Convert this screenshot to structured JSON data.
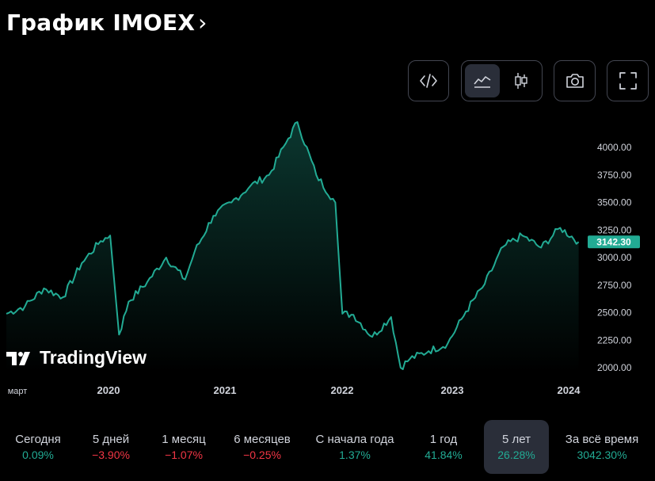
{
  "header": {
    "title": "График IMOEX",
    "chevron": "›"
  },
  "toolbar": {
    "buttons": [
      {
        "name": "embed-code",
        "icon": "code-icon"
      },
      {
        "name": "area-chart",
        "icon": "area-chart-icon",
        "active": true
      },
      {
        "name": "candles-chart",
        "icon": "candles-icon"
      },
      {
        "name": "snapshot",
        "icon": "camera-icon"
      },
      {
        "name": "fullscreen",
        "icon": "fullscreen-icon"
      }
    ]
  },
  "branding": {
    "logo_text": "TradingView"
  },
  "colors": {
    "line": "#22ab94",
    "badge": "#22ab94",
    "positive": "#22ab94",
    "negative": "#f23645"
  },
  "chart_data": {
    "type": "area",
    "symbol": "IMOEX",
    "last_value_label": "3142.30",
    "x_tick_labels": [
      "март",
      "2020",
      "2021",
      "2022",
      "2023",
      "2024"
    ],
    "y_tick_labels": [
      "4000.00",
      "3750.00",
      "3500.00",
      "3250.00",
      "3000.00",
      "2750.00",
      "2500.00",
      "2250.00",
      "2000.00"
    ],
    "ylim": [
      2000,
      4000
    ],
    "grid": false,
    "series": [
      {
        "x": [
          "2019-03",
          "2019-05",
          "2019-07",
          "2019-09",
          "2019-11",
          "2020-01",
          "2020-02",
          "2020-03",
          "2020-04",
          "2020-06",
          "2020-08",
          "2020-10",
          "2020-11",
          "2021-01",
          "2021-03",
          "2021-05",
          "2021-07",
          "2021-09",
          "2021-10",
          "2021-12",
          "2022-02",
          "2022-02-24",
          "2022-04",
          "2022-06",
          "2022-08",
          "2022-09",
          "2022-10",
          "2022-12",
          "2023-02",
          "2023-04",
          "2023-06",
          "2023-08",
          "2023-10",
          "2023-12",
          "2024-02",
          "2024-04"
        ],
        "y": [
          2490,
          2560,
          2720,
          2640,
          2950,
          3150,
          3200,
          2300,
          2600,
          2780,
          3000,
          2800,
          3050,
          3380,
          3500,
          3650,
          3750,
          4080,
          4230,
          3750,
          3500,
          2490,
          2480,
          2280,
          2460,
          2000,
          2080,
          2150,
          2220,
          2510,
          2760,
          3100,
          3200,
          3090,
          3270,
          3142
        ]
      }
    ]
  },
  "periods": [
    {
      "label": "Сегодня",
      "value": "0.09%",
      "sign": "pos"
    },
    {
      "label": "5 дней",
      "value": "−3.90%",
      "sign": "neg"
    },
    {
      "label": "1 месяц",
      "value": "−1.07%",
      "sign": "neg"
    },
    {
      "label": "6 месяцев",
      "value": "−0.25%",
      "sign": "neg"
    },
    {
      "label": "С начала года",
      "value": "1.37%",
      "sign": "pos"
    },
    {
      "label": "1 год",
      "value": "41.84%",
      "sign": "pos"
    },
    {
      "label": "5 лет",
      "value": "26.28%",
      "sign": "pos",
      "active": true
    },
    {
      "label": "За всё время",
      "value": "3042.30%",
      "sign": "pos"
    }
  ]
}
